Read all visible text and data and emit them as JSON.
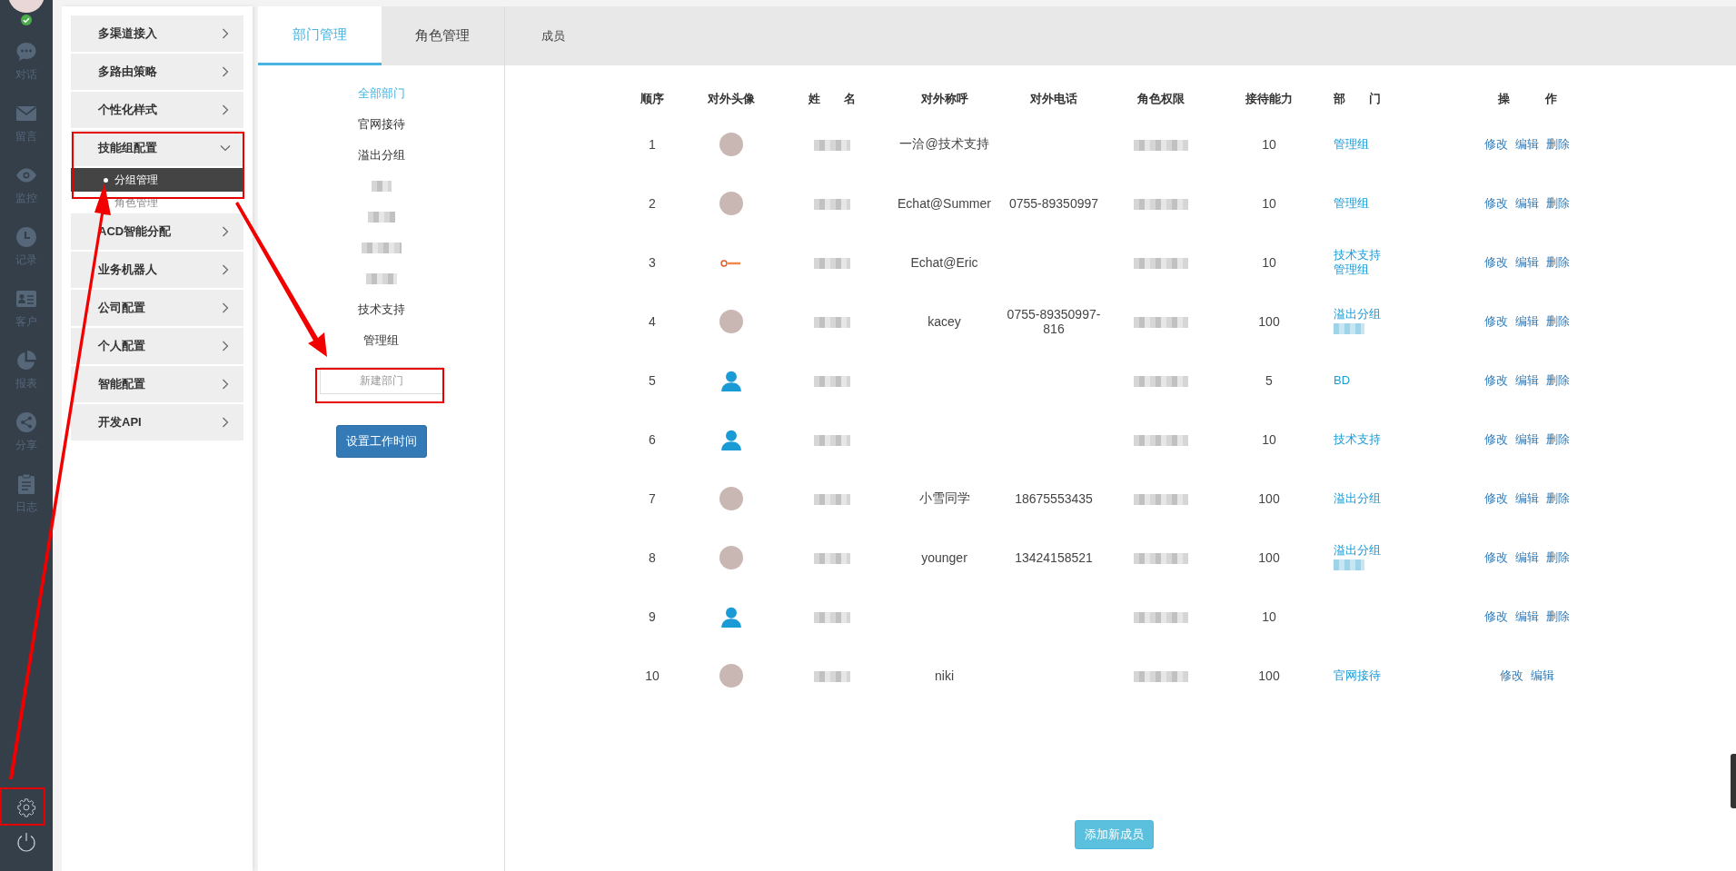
{
  "nav": {
    "online": true,
    "items": [
      {
        "label": "对话"
      },
      {
        "label": "留言"
      },
      {
        "label": "监控"
      },
      {
        "label": "记录"
      },
      {
        "label": "客户"
      },
      {
        "label": "报表"
      },
      {
        "label": "分享"
      },
      {
        "label": "日志"
      }
    ]
  },
  "settings_menu": [
    {
      "label": "多渠道接入",
      "expanded": false
    },
    {
      "label": "多路由策略",
      "expanded": false
    },
    {
      "label": "个性化样式",
      "expanded": false
    },
    {
      "label": "技能组配置",
      "expanded": true,
      "children": [
        {
          "label": "分组管理",
          "selected": true
        },
        {
          "label": "角色管理",
          "selected": false
        }
      ]
    },
    {
      "label": "ACD智能分配",
      "expanded": false
    },
    {
      "label": "业务机器人",
      "expanded": false
    },
    {
      "label": "公司配置",
      "expanded": false
    },
    {
      "label": "个人配置",
      "expanded": false
    },
    {
      "label": "智能配置",
      "expanded": false
    },
    {
      "label": "开发API",
      "expanded": false
    }
  ],
  "tabs": [
    {
      "label": "部门管理",
      "selected": true
    },
    {
      "label": "角色管理",
      "selected": false
    }
  ],
  "departments": [
    {
      "kind": "text",
      "label": "全部部门",
      "selected": true
    },
    {
      "kind": "text",
      "label": "官网接待",
      "selected": false
    },
    {
      "kind": "text",
      "label": "溢出分组",
      "selected": false
    },
    {
      "kind": "redacted",
      "selected": false
    },
    {
      "kind": "redacted",
      "selected": false
    },
    {
      "kind": "redacted",
      "selected": false
    },
    {
      "kind": "redacted",
      "selected": false
    },
    {
      "kind": "text",
      "label": "技术支持",
      "selected": false
    },
    {
      "kind": "text",
      "label": "管理组",
      "selected": false
    }
  ],
  "new_department": {
    "placeholder": "新建部门"
  },
  "work_time_button": "设置工作时间",
  "members": {
    "title": "成员",
    "columns": [
      "顺序",
      "对外头像",
      "姓　　名",
      "对外称呼",
      "对外电话",
      "角色权限",
      "接待能力",
      "部　　门",
      "操　　　作"
    ],
    "rows": [
      {
        "order": "1",
        "avatar": {
          "kind": "photo"
        },
        "name_hidden": true,
        "alias": "一洽@技术支持",
        "phone": "",
        "role_hidden": true,
        "capacity": "10",
        "departments": [
          {
            "kind": "text",
            "label": "管理组"
          }
        ],
        "actions": [
          "修改",
          "编辑",
          "删除"
        ]
      },
      {
        "order": "2",
        "avatar": {
          "kind": "photo"
        },
        "name_hidden": true,
        "alias": "Echat@Summer",
        "phone": "0755-89350997",
        "role_hidden": true,
        "capacity": "10",
        "departments": [
          {
            "kind": "text",
            "label": "管理组"
          }
        ],
        "actions": [
          "修改",
          "编辑",
          "删除"
        ]
      },
      {
        "order": "3",
        "avatar": {
          "kind": "logo"
        },
        "name_hidden": true,
        "alias": "Echat@Eric",
        "phone": "",
        "role_hidden": true,
        "capacity": "10",
        "departments": [
          {
            "kind": "text",
            "label": "技术支持"
          },
          {
            "kind": "text",
            "label": "管理组"
          }
        ],
        "actions": [
          "修改",
          "编辑",
          "删除"
        ]
      },
      {
        "order": "4",
        "avatar": {
          "kind": "photo"
        },
        "name_hidden": true,
        "alias": "kacey",
        "phone": "0755-89350997-816",
        "role_hidden": true,
        "capacity": "100",
        "departments": [
          {
            "kind": "text",
            "label": "溢出分组"
          },
          {
            "kind": "redacted"
          }
        ],
        "actions": [
          "修改",
          "编辑",
          "删除"
        ]
      },
      {
        "order": "5",
        "avatar": {
          "kind": "default"
        },
        "name_hidden": true,
        "alias": "",
        "phone": "",
        "role_hidden": true,
        "capacity": "5",
        "departments": [
          {
            "kind": "text",
            "label": "BD"
          }
        ],
        "actions": [
          "修改",
          "编辑",
          "删除"
        ]
      },
      {
        "order": "6",
        "avatar": {
          "kind": "default"
        },
        "name_hidden": true,
        "alias": "",
        "phone": "",
        "role_hidden": true,
        "capacity": "10",
        "departments": [
          {
            "kind": "text",
            "label": "技术支持"
          }
        ],
        "actions": [
          "修改",
          "编辑",
          "删除"
        ]
      },
      {
        "order": "7",
        "avatar": {
          "kind": "photo"
        },
        "name_hidden": true,
        "alias": "小雪同学",
        "phone": "18675553435",
        "role_hidden": true,
        "capacity": "100",
        "departments": [
          {
            "kind": "text",
            "label": "溢出分组"
          }
        ],
        "actions": [
          "修改",
          "编辑",
          "删除"
        ]
      },
      {
        "order": "8",
        "avatar": {
          "kind": "photo"
        },
        "name_hidden": true,
        "alias": "younger",
        "phone": "13424158521",
        "role_hidden": true,
        "capacity": "100",
        "departments": [
          {
            "kind": "text",
            "label": "溢出分组"
          },
          {
            "kind": "redacted"
          }
        ],
        "actions": [
          "修改",
          "编辑",
          "删除"
        ]
      },
      {
        "order": "9",
        "avatar": {
          "kind": "default"
        },
        "name_hidden": true,
        "alias": "",
        "phone": "",
        "role_hidden": true,
        "capacity": "10",
        "departments": [],
        "actions": [
          "修改",
          "编辑",
          "删除"
        ]
      },
      {
        "order": "10",
        "avatar": {
          "kind": "photo"
        },
        "name_hidden": true,
        "alias": "niki",
        "phone": "",
        "role_hidden": true,
        "capacity": "100",
        "departments": [
          {
            "kind": "text",
            "label": "官网接待"
          }
        ],
        "actions": [
          "修改",
          "编辑"
        ]
      }
    ],
    "add_button": "添加新成员"
  }
}
